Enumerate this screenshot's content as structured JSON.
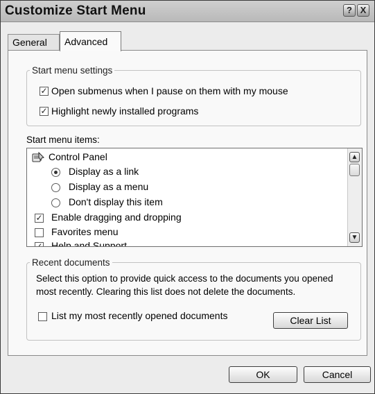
{
  "window": {
    "title": "Customize Start Menu",
    "help_glyph": "?",
    "close_glyph": "X"
  },
  "tabs": [
    {
      "label": "General",
      "selected": false
    },
    {
      "label": "Advanced",
      "selected": true
    }
  ],
  "start_menu_settings": {
    "legend": "Start menu settings",
    "options": [
      {
        "label": "Open submenus when I pause on them with my mouse",
        "checked": true
      },
      {
        "label": "Highlight newly installed programs",
        "checked": true
      }
    ]
  },
  "start_menu_items": {
    "label": "Start menu items:",
    "items": [
      {
        "type": "header",
        "label": "Control Panel",
        "icon": "control-panel-icon"
      },
      {
        "type": "radio",
        "label": "Display as a link",
        "checked": true
      },
      {
        "type": "radio",
        "label": "Display as a menu",
        "checked": false
      },
      {
        "type": "radio",
        "label": "Don't display this item",
        "checked": false
      },
      {
        "type": "checkbox",
        "label": "Enable dragging and dropping",
        "checked": true
      },
      {
        "type": "checkbox",
        "label": "Favorites menu",
        "checked": false
      },
      {
        "type": "checkbox",
        "label": "Help and Support",
        "checked": true
      }
    ]
  },
  "recent_documents": {
    "legend": "Recent documents",
    "description": "Select this option to provide quick access to the documents you opened most recently.  Clearing this list does not delete the documents.",
    "list_option": {
      "label": "List my most recently opened documents",
      "checked": false
    },
    "clear_button": "Clear List"
  },
  "footer": {
    "ok": "OK",
    "cancel": "Cancel"
  },
  "glyphs": {
    "check": "✓",
    "scroll_up": "▲",
    "scroll_down": "▼"
  }
}
